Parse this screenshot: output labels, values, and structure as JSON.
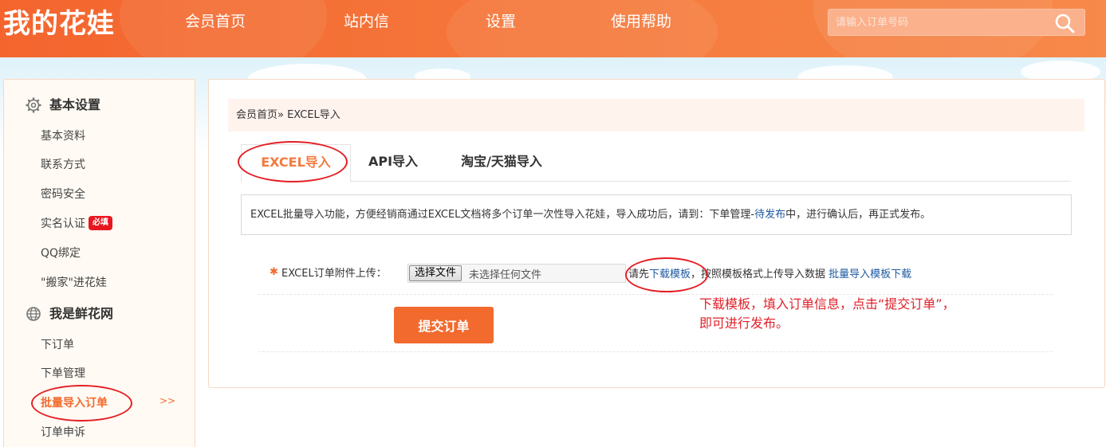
{
  "header": {
    "logo": "我的花娃",
    "nav": [
      "会员首页",
      "站内信",
      "设置",
      "使用帮助"
    ],
    "search": {
      "placeholder": "请输入订单号码",
      "icon": "search-icon"
    }
  },
  "sidebar": {
    "sections": [
      {
        "title": "基本设置",
        "icon": "gear-icon",
        "items": [
          "基本资料",
          "联系方式",
          "密码安全",
          "实名认证",
          "QQ绑定",
          "\"搬家\"进花娃"
        ]
      },
      {
        "title": "我是鲜花网",
        "icon": "globe-icon",
        "items": [
          "下订单",
          "下单管理",
          "批量导入订单",
          "订单申诉"
        ]
      }
    ],
    "badge": "必填",
    "active_arrow": ">>"
  },
  "main": {
    "breadcrumb": "会员首页» EXCEL导入",
    "tabs": [
      "EXCEL导入",
      "API导入",
      "淘宝/天猫导入"
    ],
    "info": {
      "text_before": "EXCEL批量导入功能，方便经销商通过EXCEL文档将多个订单一次性导入花娃，导入成功后，请到：下单管理-",
      "link": "待发布",
      "text_after": "中，进行确认后，再正式发布。"
    },
    "upload": {
      "label": "EXCEL订单附件上传：",
      "choose_button": "选择文件",
      "no_file": "未选择任何文件",
      "hint_prefix": "请先",
      "hint_link": "下载模板",
      "hint_middle": "，按照模板格式上传导入数据 ",
      "hint_link2": "批量导入模板下载"
    },
    "submit": "提交订单"
  },
  "annotation": {
    "line1": "下载模板，填入订单信息，点击“提交订单”，",
    "line2": "即可进行发布。"
  },
  "colors": {
    "header_orange": "#f4652e",
    "accent": "#f26a2e",
    "link": "#1e5aa0",
    "annotation_red": "#e0202a"
  }
}
